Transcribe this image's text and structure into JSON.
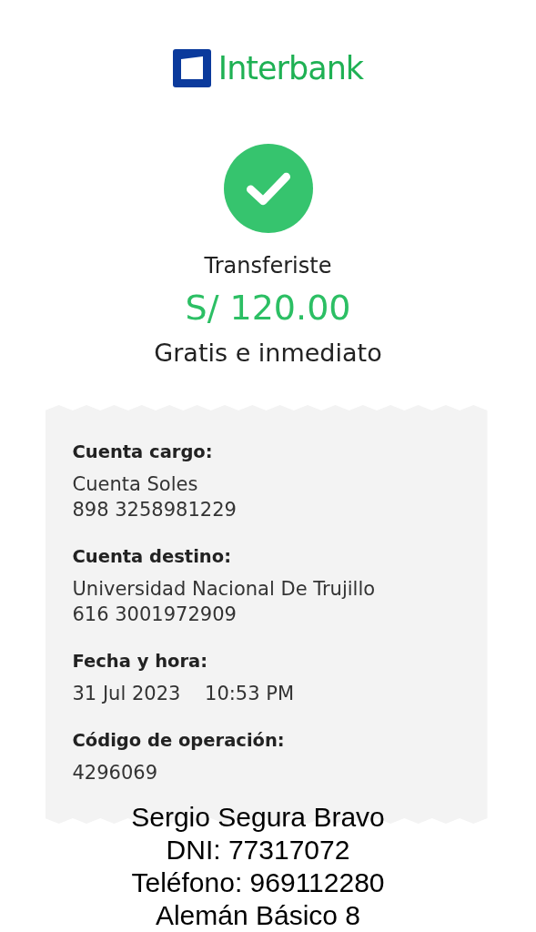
{
  "brand": {
    "name": "Interbank"
  },
  "status": {
    "kind": "success",
    "title": "Transferiste",
    "amount": "S/ 120.00",
    "subtitle": "Gratis e inmediato"
  },
  "details": [
    {
      "label": "Cuenta cargo:",
      "lines": [
        "Cuenta Soles",
        "898 3258981229"
      ]
    },
    {
      "label": "Cuenta destino:",
      "lines": [
        "Universidad Nacional De Trujillo",
        "616 3001972909"
      ]
    },
    {
      "label": "Fecha y hora:",
      "lines": [
        "31 Jul 2023    10:53 PM"
      ]
    },
    {
      "label": "Código de operación:",
      "lines": [
        "4296069"
      ]
    }
  ],
  "annotation": [
    "Sergio Segura Bravo",
    "DNI: 77317072",
    "Teléfono: 969112280",
    "Alemán Básico 8"
  ]
}
